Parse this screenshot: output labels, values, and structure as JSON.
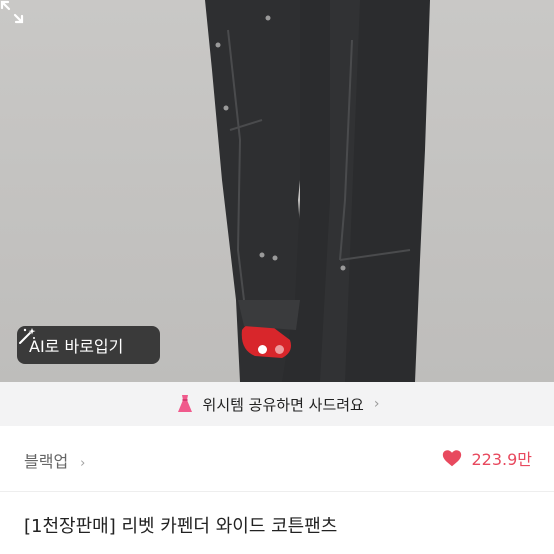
{
  "product_image": {
    "alt": ""
  },
  "ai_try_on": {
    "label": "AI로 바로입기",
    "icon": "magic-wand-icon"
  },
  "expand": {
    "icon": "expand-icon"
  },
  "carousel": {
    "total": 2,
    "active_index": 0
  },
  "wishlist_banner": {
    "text": "위시템 공유하면 사드려요",
    "icon": "dress-icon"
  },
  "seller": {
    "name": "블랙업"
  },
  "likes": {
    "count": "223.9만",
    "color": "#e8495e"
  },
  "product": {
    "title": "[1천장판매] 리벳 카펜더 와이드 코튼팬츠"
  }
}
